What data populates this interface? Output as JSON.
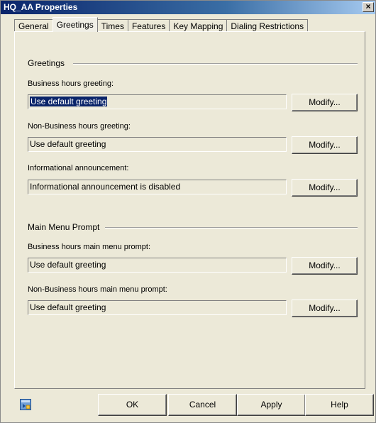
{
  "window": {
    "title": "HQ_AA Properties",
    "close_glyph": "×"
  },
  "tabs": [
    {
      "label": "General",
      "active": false
    },
    {
      "label": "Greetings",
      "active": true
    },
    {
      "label": "Times",
      "active": false
    },
    {
      "label": "Features",
      "active": false
    },
    {
      "label": "Key Mapping",
      "active": false
    },
    {
      "label": "Dialing Restrictions",
      "active": false
    }
  ],
  "greetings": {
    "heading": "Greetings",
    "business_hours": {
      "label": "Business hours greeting:",
      "value": "Use default greeting",
      "button": "Modify..."
    },
    "non_business_hours": {
      "label": "Non-Business hours greeting:",
      "value": "Use default greeting",
      "button": "Modify..."
    },
    "informational": {
      "label": "Informational announcement:",
      "value": "Informational announcement is disabled",
      "button": "Modify..."
    }
  },
  "main_menu": {
    "heading": "Main Menu Prompt",
    "business_hours": {
      "label": "Business hours main menu prompt:",
      "value": "Use default greeting",
      "button": "Modify..."
    },
    "non_business_hours": {
      "label": "Non-Business hours main menu prompt:",
      "value": "Use default greeting",
      "button": "Modify..."
    }
  },
  "footer": {
    "icon": "mmc-snapin-icon",
    "ok": "OK",
    "cancel": "Cancel",
    "apply": "Apply",
    "help": "Help"
  }
}
